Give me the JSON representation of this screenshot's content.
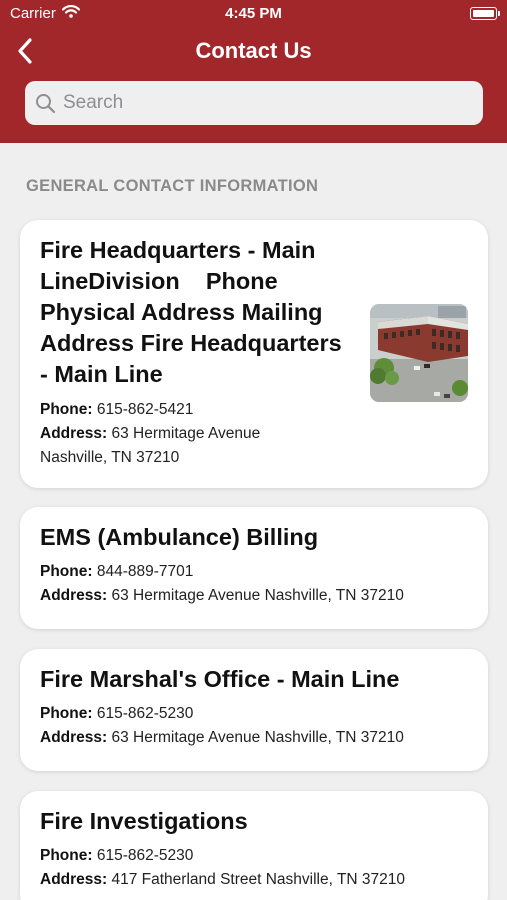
{
  "status_bar": {
    "carrier": "Carrier",
    "time": "4:45 PM"
  },
  "nav": {
    "title": "Contact Us"
  },
  "search": {
    "placeholder": "Search"
  },
  "section": {
    "title": "GENERAL CONTACT INFORMATION"
  },
  "phone_label": "Phone:",
  "address_label": "Address:",
  "contacts": [
    {
      "title": "Fire Headquarters - Main LineDivision    Phone Physical Address Mailing Address Fire Headquarters - Main Line",
      "phone": "615-862-5421",
      "address": "63 Hermitage Avenue Nashville, TN 37210"
    },
    {
      "title": "EMS (Ambulance) Billing",
      "phone": "844-889-7701",
      "address": "63 Hermitage Avenue Nashville, TN 37210"
    },
    {
      "title": "Fire Marshal's Office - Main Line",
      "phone": "615-862-5230",
      "address": "63 Hermitage Avenue Nashville, TN 37210"
    },
    {
      "title": "Fire Investigations",
      "phone": "615-862-5230",
      "address": "417 Fatherland Street Nashville, TN 37210"
    }
  ],
  "colors": {
    "header": "#a1272b",
    "background": "#efefef",
    "card": "#ffffff",
    "section_header": "#8a8a8a"
  }
}
